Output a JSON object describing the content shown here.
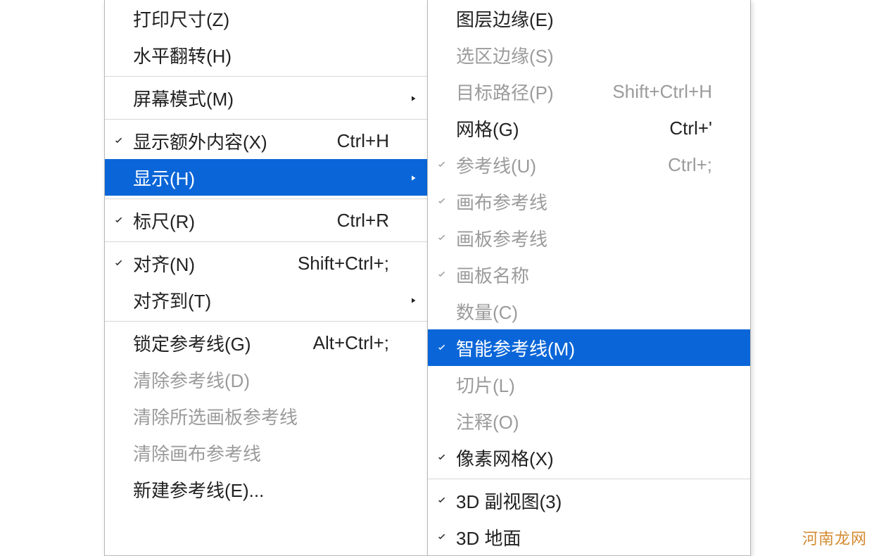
{
  "colors": {
    "highlight": "#0a66d8",
    "text": "#222222",
    "disabled": "#9b9b9b"
  },
  "watermark": "河南龙网",
  "leftMenu": [
    {
      "type": "item",
      "label": "打印尺寸(Z)",
      "shortcut": "",
      "checked": false,
      "disabled": false,
      "submenu": false,
      "selected": false
    },
    {
      "type": "item",
      "label": "水平翻转(H)",
      "shortcut": "",
      "checked": false,
      "disabled": false,
      "submenu": false,
      "selected": false
    },
    {
      "type": "sep"
    },
    {
      "type": "item",
      "label": "屏幕模式(M)",
      "shortcut": "",
      "checked": false,
      "disabled": false,
      "submenu": true,
      "selected": false
    },
    {
      "type": "sep"
    },
    {
      "type": "item",
      "label": "显示额外内容(X)",
      "shortcut": "Ctrl+H",
      "checked": true,
      "disabled": false,
      "submenu": false,
      "selected": false
    },
    {
      "type": "item",
      "label": "显示(H)",
      "shortcut": "",
      "checked": false,
      "disabled": false,
      "submenu": true,
      "selected": true
    },
    {
      "type": "sep"
    },
    {
      "type": "item",
      "label": "标尺(R)",
      "shortcut": "Ctrl+R",
      "checked": true,
      "disabled": false,
      "submenu": false,
      "selected": false
    },
    {
      "type": "sep"
    },
    {
      "type": "item",
      "label": "对齐(N)",
      "shortcut": "Shift+Ctrl+;",
      "checked": true,
      "disabled": false,
      "submenu": false,
      "selected": false
    },
    {
      "type": "item",
      "label": "对齐到(T)",
      "shortcut": "",
      "checked": false,
      "disabled": false,
      "submenu": true,
      "selected": false
    },
    {
      "type": "sep"
    },
    {
      "type": "item",
      "label": "锁定参考线(G)",
      "shortcut": "Alt+Ctrl+;",
      "checked": false,
      "disabled": false,
      "submenu": false,
      "selected": false
    },
    {
      "type": "item",
      "label": "清除参考线(D)",
      "shortcut": "",
      "checked": false,
      "disabled": true,
      "submenu": false,
      "selected": false
    },
    {
      "type": "item",
      "label": "清除所选画板参考线",
      "shortcut": "",
      "checked": false,
      "disabled": true,
      "submenu": false,
      "selected": false
    },
    {
      "type": "item",
      "label": "清除画布参考线",
      "shortcut": "",
      "checked": false,
      "disabled": true,
      "submenu": false,
      "selected": false
    },
    {
      "type": "item",
      "label": "新建参考线(E)...",
      "shortcut": "",
      "checked": false,
      "disabled": false,
      "submenu": false,
      "selected": false
    }
  ],
  "rightMenu": [
    {
      "type": "item",
      "label": "图层边缘(E)",
      "shortcut": "",
      "checked": false,
      "disabled": false,
      "submenu": false,
      "selected": false
    },
    {
      "type": "item",
      "label": "选区边缘(S)",
      "shortcut": "",
      "checked": false,
      "disabled": true,
      "submenu": false,
      "selected": false
    },
    {
      "type": "item",
      "label": "目标路径(P)",
      "shortcut": "Shift+Ctrl+H",
      "checked": false,
      "disabled": true,
      "submenu": false,
      "selected": false
    },
    {
      "type": "item",
      "label": "网格(G)",
      "shortcut": "Ctrl+'",
      "checked": false,
      "disabled": false,
      "submenu": false,
      "selected": false
    },
    {
      "type": "item",
      "label": "参考线(U)",
      "shortcut": "Ctrl+;",
      "checked": true,
      "disabled": true,
      "submenu": false,
      "selected": false
    },
    {
      "type": "item",
      "label": "画布参考线",
      "shortcut": "",
      "checked": true,
      "disabled": true,
      "submenu": false,
      "selected": false
    },
    {
      "type": "item",
      "label": "画板参考线",
      "shortcut": "",
      "checked": true,
      "disabled": true,
      "submenu": false,
      "selected": false
    },
    {
      "type": "item",
      "label": "画板名称",
      "shortcut": "",
      "checked": true,
      "disabled": true,
      "submenu": false,
      "selected": false
    },
    {
      "type": "item",
      "label": "数量(C)",
      "shortcut": "",
      "checked": false,
      "disabled": true,
      "submenu": false,
      "selected": false
    },
    {
      "type": "item",
      "label": "智能参考线(M)",
      "shortcut": "",
      "checked": true,
      "disabled": false,
      "submenu": false,
      "selected": true
    },
    {
      "type": "item",
      "label": "切片(L)",
      "shortcut": "",
      "checked": false,
      "disabled": true,
      "submenu": false,
      "selected": false
    },
    {
      "type": "item",
      "label": "注释(O)",
      "shortcut": "",
      "checked": false,
      "disabled": true,
      "submenu": false,
      "selected": false
    },
    {
      "type": "item",
      "label": "像素网格(X)",
      "shortcut": "",
      "checked": true,
      "disabled": false,
      "submenu": false,
      "selected": false
    },
    {
      "type": "sep"
    },
    {
      "type": "item",
      "label": "3D 副视图(3)",
      "shortcut": "",
      "checked": true,
      "disabled": false,
      "submenu": false,
      "selected": false
    },
    {
      "type": "item",
      "label": "3D 地面",
      "shortcut": "",
      "checked": true,
      "disabled": false,
      "submenu": false,
      "selected": false
    }
  ]
}
